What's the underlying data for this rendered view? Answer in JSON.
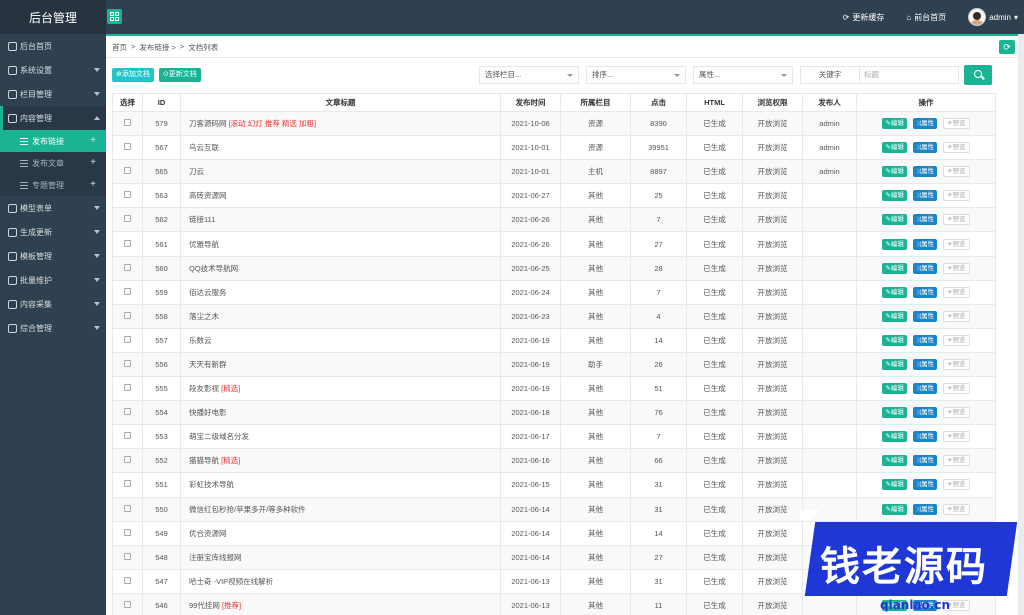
{
  "header": {
    "brand": "后台管理",
    "clear_cache": "更新缓存",
    "front_home": "前台首页",
    "user": "admin"
  },
  "sidebar": {
    "items": [
      {
        "label": "后台首页",
        "icon": "home-icon"
      },
      {
        "label": "系统设置",
        "icon": "gear-icon"
      },
      {
        "label": "栏目管理",
        "icon": "columns-icon"
      },
      {
        "label": "内容管理",
        "icon": "content-icon"
      },
      {
        "label": "模型表单",
        "icon": "model-icon"
      },
      {
        "label": "生成更新",
        "icon": "refresh-icon"
      },
      {
        "label": "模板管理",
        "icon": "template-icon"
      },
      {
        "label": "批量维护",
        "icon": "batch-icon"
      },
      {
        "label": "内容采集",
        "icon": "collect-icon"
      },
      {
        "label": "综合管理",
        "icon": "settings-icon"
      }
    ],
    "subitems": [
      "发布链接",
      "发布文章",
      "专题管理"
    ]
  },
  "breadcrumb": [
    "首页",
    ">",
    "发布链接 >",
    ">",
    "文档列表"
  ],
  "toolbar": {
    "add": "添加文档",
    "update": "更新文档",
    "column_select": "选择栏目...",
    "sort_select": "排序...",
    "attr_select": "属性...",
    "keyword_label": "关键字",
    "keyword_placeholder": "标题"
  },
  "table": {
    "headers": [
      "选择",
      "ID",
      "文章标题",
      "发布时间",
      "所属栏目",
      "点击",
      "HTML",
      "浏览权限",
      "发布人",
      "操作"
    ],
    "op_labels": {
      "edit": "编辑",
      "attr": "属性",
      "preview": "预览"
    },
    "rows": [
      {
        "id": "579",
        "title": "刀客源码网",
        "flag": "[滚动 幻灯 推荐 精选 加粗]",
        "date": "2021-10-06",
        "column": "资源",
        "clicks": "8390",
        "html": "已生成",
        "perm": "开放浏览",
        "author": "admin"
      },
      {
        "id": "567",
        "title": "乌云互联",
        "flag": "",
        "date": "2021-10-01",
        "column": "资源",
        "clicks": "39951",
        "html": "已生成",
        "perm": "开放浏览",
        "author": "admin"
      },
      {
        "id": "565",
        "title": "刀云",
        "flag": "",
        "date": "2021-10-01",
        "column": "主机",
        "clicks": "8897",
        "html": "已生成",
        "perm": "开放浏览",
        "author": "admin"
      },
      {
        "id": "563",
        "title": "高砖资源网",
        "flag": "",
        "date": "2021-06-27",
        "column": "其他",
        "clicks": "25",
        "html": "已生成",
        "perm": "开放浏览",
        "author": ""
      },
      {
        "id": "562",
        "title": "链接111",
        "flag": "",
        "date": "2021-06-26",
        "column": "其他",
        "clicks": "7",
        "html": "已生成",
        "perm": "开放浏览",
        "author": ""
      },
      {
        "id": "561",
        "title": "优雅导航",
        "flag": "",
        "date": "2021-06-26",
        "column": "其他",
        "clicks": "27",
        "html": "已生成",
        "perm": "开放浏览",
        "author": ""
      },
      {
        "id": "560",
        "title": "QQ技术导航网",
        "flag": "",
        "date": "2021-06-25",
        "column": "其他",
        "clicks": "28",
        "html": "已生成",
        "perm": "开放浏览",
        "author": ""
      },
      {
        "id": "559",
        "title": "佰达云服务",
        "flag": "",
        "date": "2021-06-24",
        "column": "其他",
        "clicks": "7",
        "html": "已生成",
        "perm": "开放浏览",
        "author": ""
      },
      {
        "id": "558",
        "title": "落尘之木",
        "flag": "",
        "date": "2021-06-23",
        "column": "其他",
        "clicks": "4",
        "html": "已生成",
        "perm": "开放浏览",
        "author": ""
      },
      {
        "id": "557",
        "title": "乐数云",
        "flag": "",
        "date": "2021-06-19",
        "column": "其他",
        "clicks": "14",
        "html": "已生成",
        "perm": "开放浏览",
        "author": ""
      },
      {
        "id": "556",
        "title": "天天有新群",
        "flag": "",
        "date": "2021-06-19",
        "column": "助手",
        "clicks": "26",
        "html": "已生成",
        "perm": "开放浏览",
        "author": ""
      },
      {
        "id": "555",
        "title": "段友影视",
        "flag": "[精选]",
        "date": "2021-06-19",
        "column": "其他",
        "clicks": "51",
        "html": "已生成",
        "perm": "开放浏览",
        "author": ""
      },
      {
        "id": "554",
        "title": "快播好电影",
        "flag": "",
        "date": "2021-06-18",
        "column": "其他",
        "clicks": "76",
        "html": "已生成",
        "perm": "开放浏览",
        "author": ""
      },
      {
        "id": "553",
        "title": "萌宝二级域名分发",
        "flag": "",
        "date": "2021-06-17",
        "column": "其他",
        "clicks": "7",
        "html": "已生成",
        "perm": "开放浏览",
        "author": ""
      },
      {
        "id": "552",
        "title": "猫猫导航",
        "flag": "[精选]",
        "date": "2021-06-16",
        "column": "其他",
        "clicks": "66",
        "html": "已生成",
        "perm": "开放浏览",
        "author": ""
      },
      {
        "id": "551",
        "title": "彩虹技术导航",
        "flag": "",
        "date": "2021-06-15",
        "column": "其他",
        "clicks": "31",
        "html": "已生成",
        "perm": "开放浏览",
        "author": ""
      },
      {
        "id": "550",
        "title": "微信红包秒抢/苹果多开/等多种软件",
        "flag": "",
        "date": "2021-06-14",
        "column": "其他",
        "clicks": "31",
        "html": "已生成",
        "perm": "开放浏览",
        "author": ""
      },
      {
        "id": "549",
        "title": "优合资源网",
        "flag": "",
        "date": "2021-06-14",
        "column": "其他",
        "clicks": "14",
        "html": "已生成",
        "perm": "开放浏览",
        "author": ""
      },
      {
        "id": "548",
        "title": "注册宝库线报网",
        "flag": "",
        "date": "2021-06-14",
        "column": "其他",
        "clicks": "27",
        "html": "已生成",
        "perm": "开放浏览",
        "author": ""
      },
      {
        "id": "547",
        "title": "哈士奇 -VIP视频在线解析",
        "flag": "",
        "date": "2021-06-13",
        "column": "其他",
        "clicks": "31",
        "html": "已生成",
        "perm": "开放浏览",
        "author": ""
      },
      {
        "id": "546",
        "title": "99代挂网",
        "flag": "[推荐]",
        "date": "2021-06-13",
        "column": "其他",
        "clicks": "11",
        "html": "已生成",
        "perm": "开放浏览",
        "author": ""
      }
    ]
  },
  "watermark": {
    "text": "钱老源码",
    "url": "qianlao.cn"
  },
  "colors": {
    "accent": "#1ab394",
    "sidebar": "#2f4050",
    "info": "#1c84c6",
    "watermark": "#1f37d6"
  }
}
